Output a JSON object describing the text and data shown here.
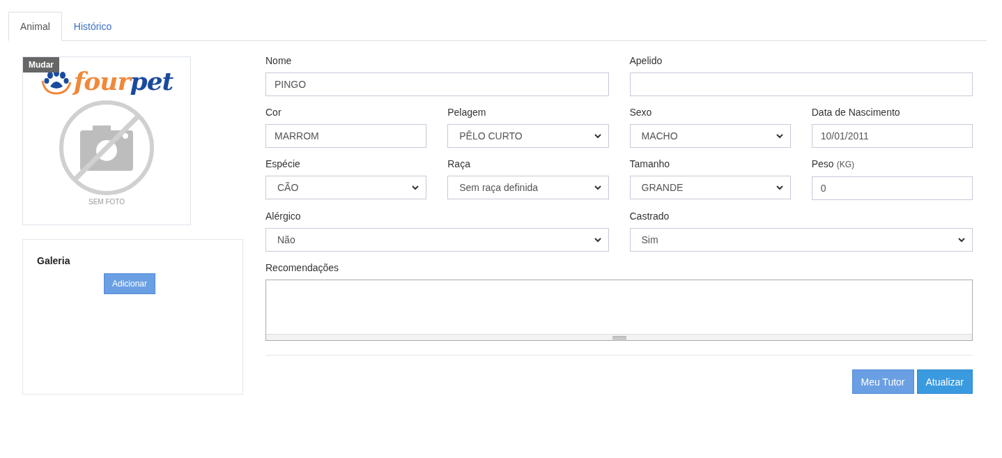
{
  "tabs": [
    {
      "label": "Animal",
      "selected": true
    },
    {
      "label": "Histórico",
      "selected": false
    }
  ],
  "photo": {
    "change_label": "Mudar",
    "logo_parts": [
      "four",
      "pet"
    ],
    "caption": "SEM FOTO"
  },
  "gallery": {
    "title": "Galeria",
    "add_button": "Adicionar"
  },
  "form_rows": [
    [
      {
        "kind": "input",
        "label": "Nome",
        "value": "PINGO"
      },
      {
        "kind": "input",
        "label": "Apelido"
      }
    ],
    [
      {
        "kind": "input",
        "label": "Cor",
        "value": "MARROM"
      },
      {
        "kind": "select",
        "label": "Pelagem",
        "value": "PÊLO CURTO"
      },
      {
        "kind": "select",
        "label": "Sexo",
        "value": "MACHO"
      },
      {
        "kind": "input",
        "label": "Data de Nascimento",
        "value": "10/01/2011"
      }
    ],
    [
      {
        "kind": "select",
        "label": "Espécie",
        "value": "CÃO"
      },
      {
        "kind": "select",
        "label": "Raça",
        "value": "Sem raça definida"
      },
      {
        "kind": "select",
        "label": "Tamanho",
        "value": "GRANDE"
      },
      {
        "kind": "input",
        "label": "Peso",
        "unit": "(KG)",
        "value": "0"
      }
    ],
    [
      {
        "kind": "select",
        "label": "Alérgico",
        "value": "Não"
      },
      {
        "kind": "select",
        "label": "Castrado",
        "value": "Sim"
      }
    ],
    [
      {
        "kind": "textarea",
        "label": "Recomendações"
      }
    ]
  ],
  "buttons": [
    {
      "kind": "secondary",
      "label": "Meu Tutor"
    },
    {
      "kind": "primary",
      "label": "Atualizar"
    }
  ]
}
